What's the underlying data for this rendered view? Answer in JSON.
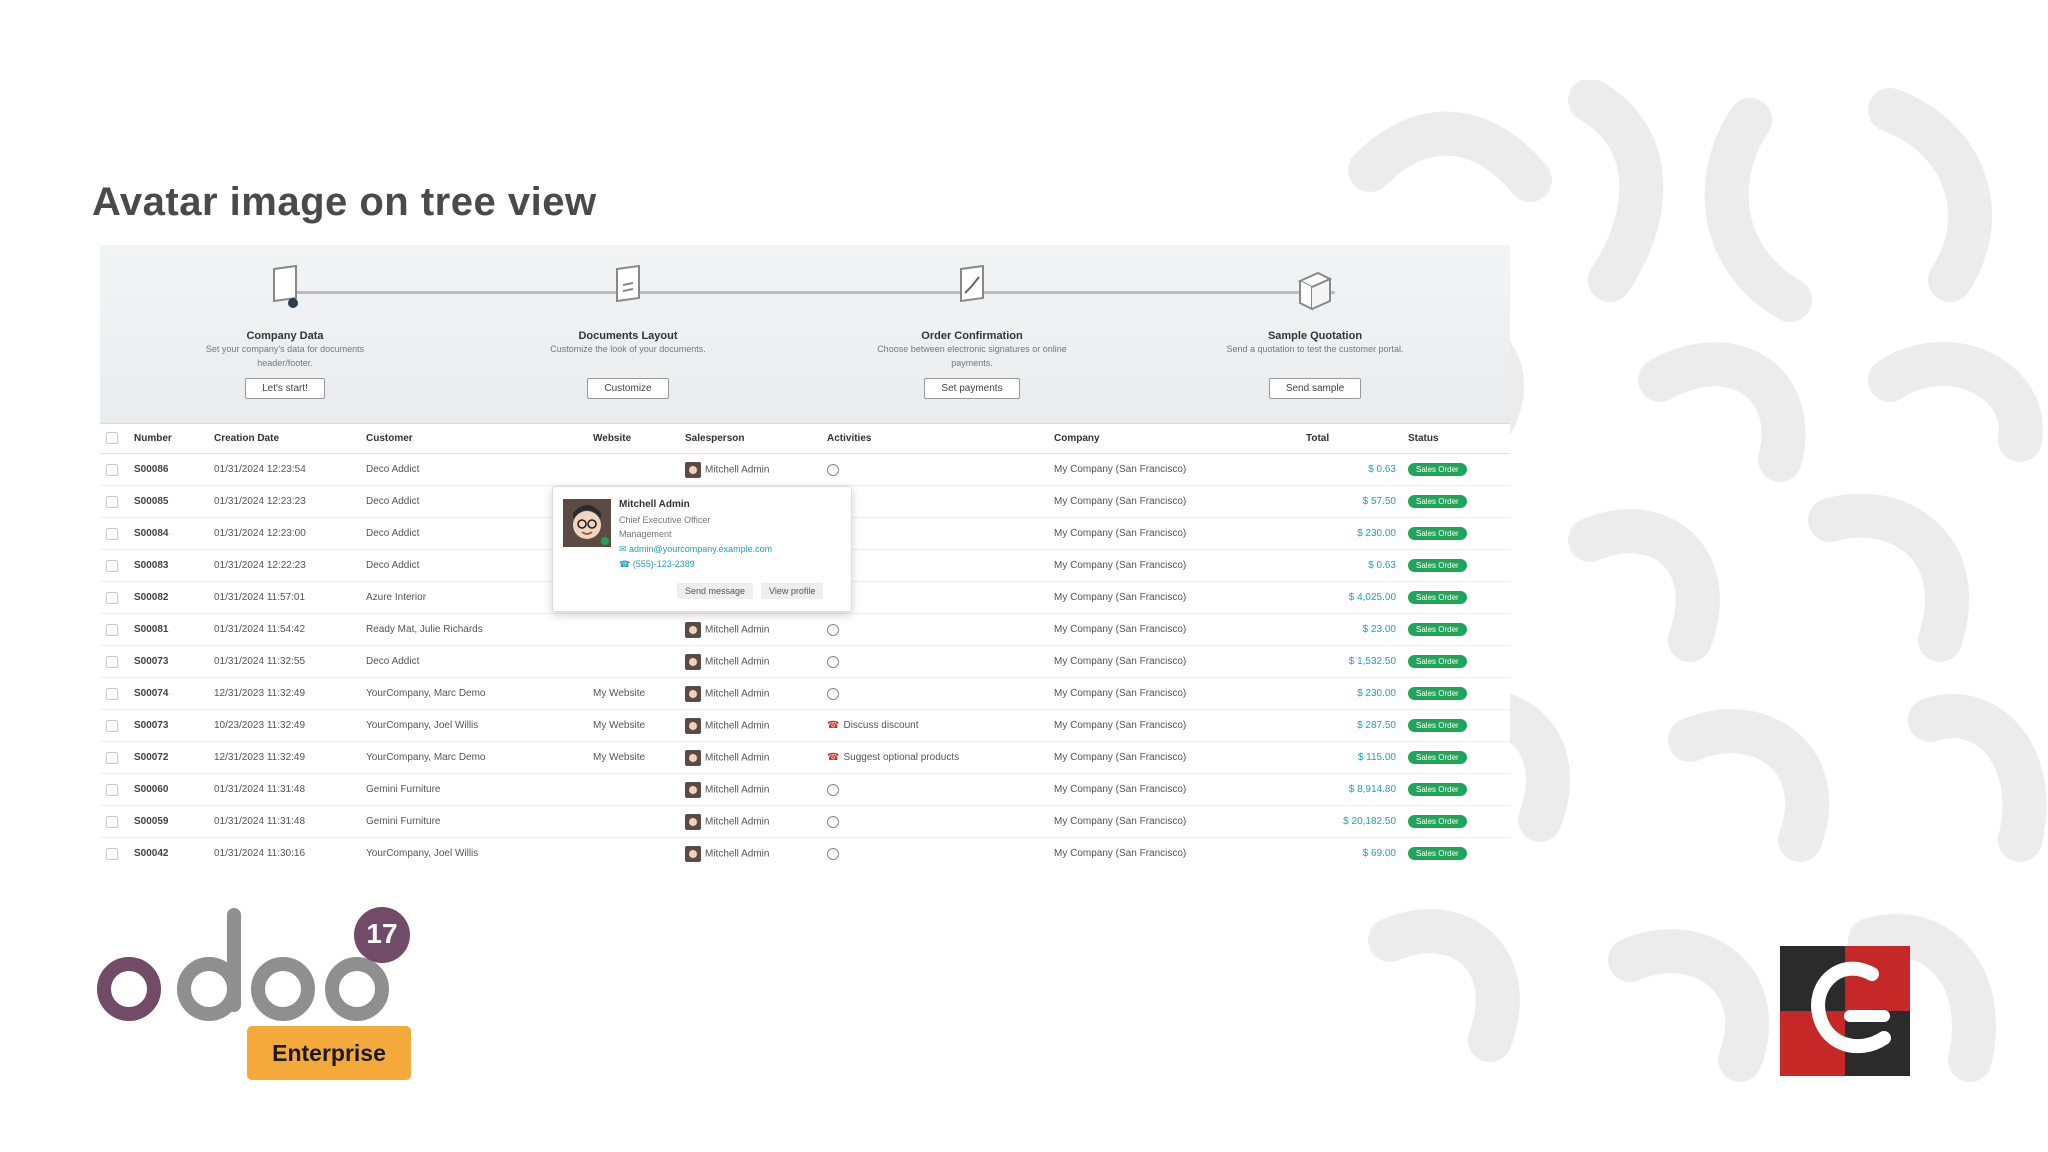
{
  "slide": {
    "title": "Avatar image on tree view"
  },
  "onboarding": [
    {
      "title": "Company Data",
      "desc": "Set your company's data for documents header/footer.",
      "button": "Let's start!"
    },
    {
      "title": "Documents Layout",
      "desc": "Customize the look of your documents.",
      "button": "Customize"
    },
    {
      "title": "Order Confirmation",
      "desc": "Choose between electronic signatures or online payments.",
      "button": "Set payments"
    },
    {
      "title": "Sample Quotation",
      "desc": "Send a quotation to test the customer portal.",
      "button": "Send sample"
    }
  ],
  "table": {
    "headers": {
      "number": "Number",
      "date": "Creation Date",
      "customer": "Customer",
      "website": "Website",
      "salesperson": "Salesperson",
      "activities": "Activities",
      "company": "Company",
      "total": "Total",
      "status": "Status"
    },
    "rows": [
      {
        "number": "S00086",
        "date": "01/31/2024 12:23:54",
        "customer": "Deco Addict",
        "website": "",
        "salesperson": "Mitchell Admin",
        "activity": "",
        "activity_icon": "clock-icon",
        "company": "My Company (San Francisco)",
        "total": "$ 0.63",
        "status": "Sales Order"
      },
      {
        "number": "S00085",
        "date": "01/31/2024 12:23:23",
        "customer": "Deco Addict",
        "website": "",
        "salesperson": "",
        "activity": "",
        "activity_icon": "",
        "company": "My Company (San Francisco)",
        "total": "$ 57.50",
        "status": "Sales Order"
      },
      {
        "number": "S00084",
        "date": "01/31/2024 12:23:00",
        "customer": "Deco Addict",
        "website": "",
        "salesperson": "",
        "activity": "",
        "activity_icon": "",
        "company": "My Company (San Francisco)",
        "total": "$ 230.00",
        "status": "Sales Order"
      },
      {
        "number": "S00083",
        "date": "01/31/2024 12:22:23",
        "customer": "Deco Addict",
        "website": "",
        "salesperson": "",
        "activity": "",
        "activity_icon": "",
        "company": "My Company (San Francisco)",
        "total": "$ 0.63",
        "status": "Sales Order"
      },
      {
        "number": "S00082",
        "date": "01/31/2024 11:57:01",
        "customer": "Azure Interior",
        "website": "",
        "salesperson": "",
        "activity": "",
        "activity_icon": "",
        "company": "My Company (San Francisco)",
        "total": "$ 4,025.00",
        "status": "Sales Order"
      },
      {
        "number": "S00081",
        "date": "01/31/2024 11:54:42",
        "customer": "Ready Mat, Julie Richards",
        "website": "",
        "salesperson": "Mitchell Admin",
        "activity": "",
        "activity_icon": "clock-icon",
        "company": "My Company (San Francisco)",
        "total": "$ 23.00",
        "status": "Sales Order"
      },
      {
        "number": "S00073",
        "date": "01/31/2024 11:32:55",
        "customer": "Deco Addict",
        "website": "",
        "salesperson": "Mitchell Admin",
        "activity": "",
        "activity_icon": "clock-icon",
        "company": "My Company (San Francisco)",
        "total": "$ 1,532.50",
        "status": "Sales Order"
      },
      {
        "number": "S00074",
        "date": "12/31/2023 11:32:49",
        "customer": "YourCompany, Marc Demo",
        "website": "My Website",
        "salesperson": "Mitchell Admin",
        "activity": "",
        "activity_icon": "clock-icon",
        "company": "My Company (San Francisco)",
        "total": "$ 230.00",
        "status": "Sales Order"
      },
      {
        "number": "S00073",
        "date": "10/23/2023 11:32:49",
        "customer": "YourCompany, Joel Willis",
        "website": "My Website",
        "salesperson": "Mitchell Admin",
        "activity": "Discuss discount",
        "activity_icon": "phone-icon",
        "company": "My Company (San Francisco)",
        "total": "$ 287.50",
        "status": "Sales Order"
      },
      {
        "number": "S00072",
        "date": "12/31/2023 11:32:49",
        "customer": "YourCompany, Marc Demo",
        "website": "My Website",
        "salesperson": "Mitchell Admin",
        "activity": "Suggest optional products",
        "activity_icon": "phone-icon",
        "company": "My Company (San Francisco)",
        "total": "$ 115.00",
        "status": "Sales Order"
      },
      {
        "number": "S00060",
        "date": "01/31/2024 11:31:48",
        "customer": "Gemini Furniture",
        "website": "",
        "salesperson": "Mitchell Admin",
        "activity": "",
        "activity_icon": "clock-icon",
        "company": "My Company (San Francisco)",
        "total": "$ 8,914.80",
        "status": "Sales Order"
      },
      {
        "number": "S00059",
        "date": "01/31/2024 11:31:48",
        "customer": "Gemini Furniture",
        "website": "",
        "salesperson": "Mitchell Admin",
        "activity": "",
        "activity_icon": "clock-icon",
        "company": "My Company (San Francisco)",
        "total": "$ 20,182.50",
        "status": "Sales Order"
      },
      {
        "number": "S00042",
        "date": "01/31/2024 11:30:16",
        "customer": "YourCompany, Joel Willis",
        "website": "",
        "salesperson": "Mitchell Admin",
        "activity": "",
        "activity_icon": "clock-icon",
        "company": "My Company (San Francisco)",
        "total": "$ 69.00",
        "status": "Sales Order"
      }
    ]
  },
  "popover": {
    "name": "Mitchell Admin",
    "job": "Chief Executive Officer",
    "department": "Management",
    "email": "admin@yourcompany.example.com",
    "phone": "(555)-123-2389",
    "send_message": "Send message",
    "view_profile": "View profile"
  },
  "branding": {
    "product_version": "17",
    "edition": "Enterprise",
    "colors": {
      "odoo_purple": "#714b67",
      "odoo_grey": "#8f8f8f",
      "edition_bg": "#f4a93b",
      "status_green": "#22a35a",
      "total_blue": "#1f9fc4"
    }
  }
}
